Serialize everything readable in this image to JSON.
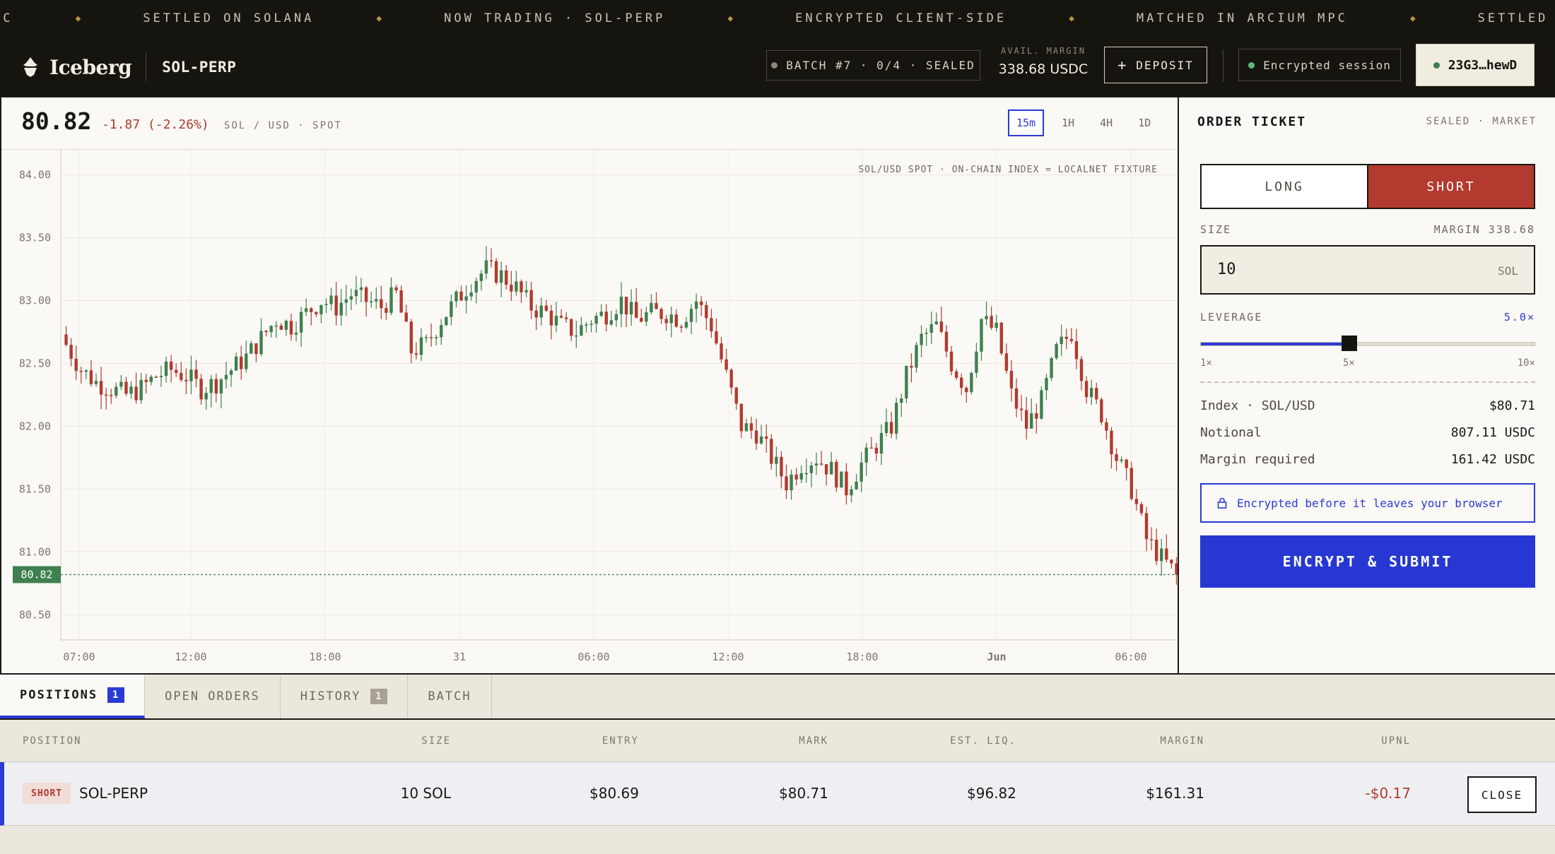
{
  "ticker": {
    "items": [
      "PC",
      "SETTLED ON SOLANA",
      "NOW TRADING · SOL-PERP",
      "ENCRYPTED CLIENT-SIDE",
      "MATCHED IN ARCIUM MPC",
      "SETTLED ON SOLANA"
    ]
  },
  "header": {
    "brand": "Iceberg",
    "market": "SOL-PERP",
    "batch": "BATCH #7 · 0/4 · SEALED",
    "avail_label": "AVAIL. MARGIN",
    "avail_value": "338.68 USDC",
    "deposit_label": "DEPOSIT",
    "session_label": "Encrypted session",
    "wallet": "23G3…hewD",
    "colors": {
      "bg": "#16140f",
      "session_dot": "#5fb87a",
      "batch_dot": "#8e887a"
    }
  },
  "price": {
    "last": "80.82",
    "change": "-1.87 (-2.26%)",
    "pair": "SOL / USD · SPOT",
    "timeframes": [
      "15m",
      "1H",
      "4H",
      "1D"
    ],
    "active_timeframe": "15m"
  },
  "chart_data": {
    "type": "candlestick",
    "annotation": "SOL/USD SPOT · ON-CHAIN INDEX = LOCALNET FIXTURE",
    "y_ticks": [
      "84.00",
      "83.50",
      "83.00",
      "82.50",
      "82.00",
      "81.50",
      "81.00",
      "80.50"
    ],
    "ylim": [
      80.3,
      84.2
    ],
    "x_ticks": [
      "07:00",
      "12:00",
      "18:00",
      "31",
      "06:00",
      "12:00",
      "18:00",
      "Jun",
      "06:00"
    ],
    "current_price": 80.82,
    "current_price_label": "80.82",
    "close_series": [
      82.65,
      82.45,
      82.35,
      82.3,
      82.25,
      82.3,
      82.4,
      82.45,
      82.4,
      82.3,
      82.35,
      82.45,
      82.55,
      82.7,
      82.85,
      82.8,
      82.9,
      83.0,
      82.95,
      83.05,
      83.0,
      82.95,
      83.05,
      82.6,
      82.65,
      82.85,
      83.0,
      83.15,
      83.25,
      83.2,
      83.1,
      82.95,
      82.9,
      82.8,
      82.75,
      82.85,
      82.9,
      83.0,
      82.85,
      82.9,
      82.9,
      82.85,
      83.0,
      82.8,
      82.4,
      82.0,
      81.95,
      81.75,
      81.55,
      81.7,
      81.75,
      81.65,
      81.5,
      81.7,
      81.85,
      82.0,
      82.4,
      82.7,
      82.8,
      82.5,
      82.3,
      82.85,
      82.75,
      82.25,
      82.0,
      82.2,
      82.6,
      82.75,
      82.3,
      82.1,
      81.75,
      81.5,
      81.1,
      80.95,
      80.82
    ],
    "colors": {
      "up": "#3f7f4f",
      "down": "#b23a2e"
    }
  },
  "ticket": {
    "title": "ORDER TICKET",
    "mode": "SEALED · MARKET",
    "long_label": "LONG",
    "short_label": "SHORT",
    "active_side": "SHORT",
    "size_label": "SIZE",
    "margin_label": "MARGIN 338.68",
    "size_value": "10",
    "size_unit": "SOL",
    "leverage_label": "LEVERAGE",
    "leverage_value": "5.0×",
    "leverage_fraction": 0.444,
    "lev_min": "1×",
    "lev_mid": "5×",
    "lev_max": "10×",
    "rows": [
      {
        "label": "Index · SOL/USD",
        "value": "$80.71"
      },
      {
        "label": "Notional",
        "value": "807.11 USDC"
      },
      {
        "label": "Margin required",
        "value": "161.42 USDC"
      }
    ],
    "encrypt_note": "Encrypted before it leaves your browser",
    "submit_label": "ENCRYPT & SUBMIT"
  },
  "bottom": {
    "tabs": [
      {
        "label": "POSITIONS",
        "badge": "1"
      },
      {
        "label": "OPEN ORDERS",
        "badge": ""
      },
      {
        "label": "HISTORY",
        "badge": "1"
      },
      {
        "label": "BATCH",
        "badge": ""
      }
    ],
    "columns": [
      "POSITION",
      "SIZE",
      "ENTRY",
      "MARK",
      "EST. LIQ.",
      "MARGIN",
      "UPNL"
    ],
    "positions": [
      {
        "side": "SHORT",
        "market": "SOL-PERP",
        "size": "10 SOL",
        "entry": "$80.69",
        "mark": "$80.71",
        "liq": "$96.82",
        "margin": "$161.31",
        "upnl": "-$0.17",
        "action": "CLOSE"
      }
    ]
  }
}
